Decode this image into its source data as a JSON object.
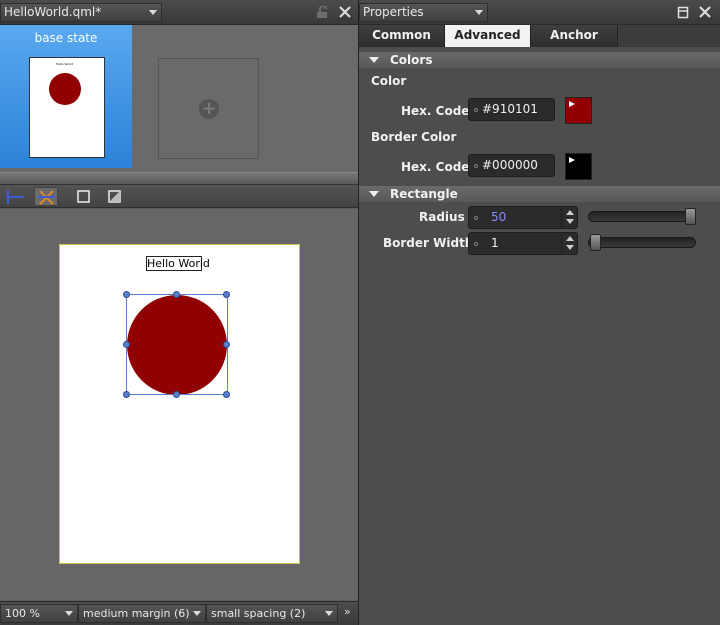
{
  "left_panel": {
    "document_title": "HelloWorld.qml*",
    "states": {
      "base_state_label": "base state",
      "thumb_text": "Hello World"
    },
    "canvas": {
      "text_item": "Hello World",
      "circle_color": "#910101"
    },
    "statusbar": {
      "zoom": "100 %",
      "margin": "medium margin (6)",
      "spacing": "small spacing (2)"
    },
    "toolbar_icons": [
      "anchor-icon",
      "snap-icon",
      "rect-icon",
      "background-icon"
    ]
  },
  "right_panel": {
    "title": "Properties",
    "tabs": [
      {
        "label": "Common"
      },
      {
        "label": "Advanced"
      },
      {
        "label": "Anchor"
      }
    ],
    "active_tab": "Advanced",
    "colors_section": {
      "header": "Colors",
      "color_label": "Color",
      "color_hex_label": "Hex. Code",
      "color_hex_value": "#910101",
      "color_swatch": "#910101",
      "border_color_label": "Border Color",
      "border_hex_label": "Hex. Code",
      "border_hex_value": "#000000",
      "border_swatch": "#000000"
    },
    "rectangle_section": {
      "header": "Rectangle",
      "radius_label": "Radius",
      "radius_value": "50",
      "border_width_label": "Border Width",
      "border_width_value": "1"
    }
  },
  "colors": {
    "accent_blue": "#2b82d8",
    "selection": "#5b7fd0",
    "circle": "#910101"
  }
}
